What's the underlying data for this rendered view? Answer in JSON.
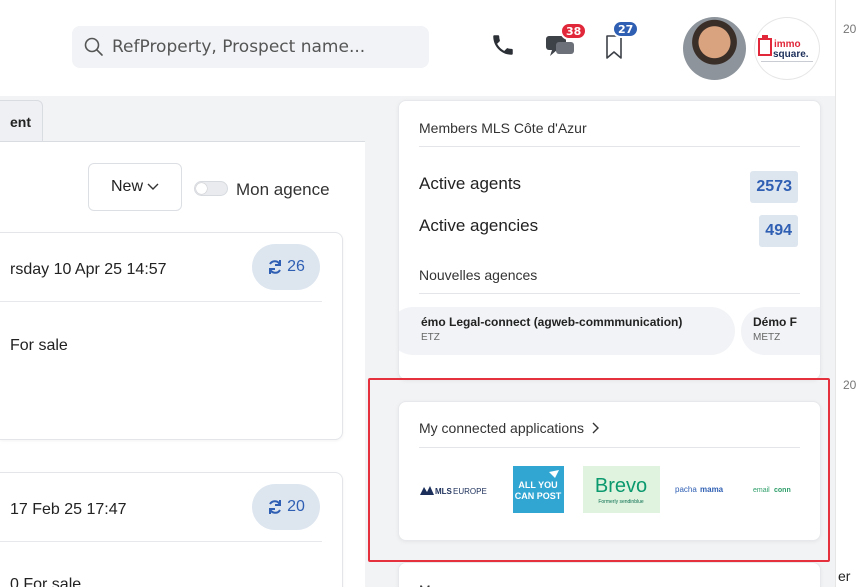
{
  "search": {
    "placeholder": "RefProperty, Prospect name..."
  },
  "header": {
    "messages_count": "38",
    "bookmarks_count": "27",
    "brand_logo": {
      "line1": "immo",
      "line2": "square."
    }
  },
  "left": {
    "tab_label": "ent",
    "new_label": "New",
    "toggle_label": "Mon agence",
    "listings": [
      {
        "date": "rsday 10 Apr 25 14:57",
        "count": "26",
        "status": "For sale"
      },
      {
        "date": "17 Feb 25 17:47",
        "count": "20",
        "status": "0 For sale"
      }
    ]
  },
  "right": {
    "members_title": "Members MLS Côte d'Azur",
    "active_agents_label": "Active agents",
    "active_agents_value": "2573",
    "active_agencies_label": "Active agencies",
    "active_agencies_value": "494",
    "nouvelles_title": "Nouvelles agences",
    "new_agencies": [
      {
        "name": "émo Legal-connect (agweb-commmunication)",
        "city": "ETZ"
      },
      {
        "name": "Démo F",
        "city": "METZ"
      }
    ],
    "apps_title": "My connected applications",
    "apps": [
      {
        "name": "MLS EUROPE",
        "text_a": "MLS",
        "text_b": "EUROPE"
      },
      {
        "name": "ALL YOU CAN POST",
        "text_a": "ALL YOU",
        "text_b": "CAN POST"
      },
      {
        "name": "Brevo",
        "text_a": "Brevo",
        "text_b": "Formerly sendinblue"
      },
      {
        "name": "pachamama",
        "text_a": "pacha",
        "text_b": "mama"
      },
      {
        "name": "emailconn",
        "text_a": "email",
        "text_b": "conn"
      }
    ],
    "next_title": "M"
  },
  "edge": {
    "t1": "20",
    "t2": "20",
    "t3": "er"
  },
  "colors": {
    "accent": "#2f5fb3",
    "badge_red": "#e0283a",
    "highlight": "#e5303d",
    "pill_bg": "#dde5ef"
  }
}
